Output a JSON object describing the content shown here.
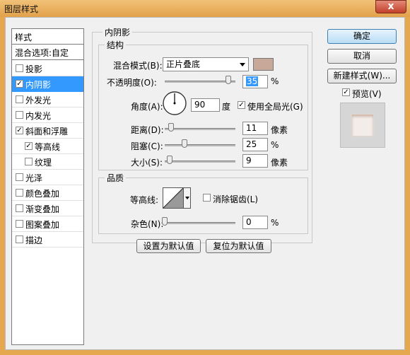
{
  "window": {
    "title": "图层样式",
    "close_glyph": "x"
  },
  "sidebar": {
    "header": "样式",
    "blend_options": "混合选项:自定",
    "items": [
      {
        "label": "投影",
        "checked": false,
        "selected": false,
        "indent": false
      },
      {
        "label": "内阴影",
        "checked": true,
        "selected": true,
        "indent": false
      },
      {
        "label": "外发光",
        "checked": false,
        "selected": false,
        "indent": false
      },
      {
        "label": "内发光",
        "checked": false,
        "selected": false,
        "indent": false
      },
      {
        "label": "斜面和浮雕",
        "checked": true,
        "selected": false,
        "indent": false
      },
      {
        "label": "等高线",
        "checked": true,
        "selected": false,
        "indent": true
      },
      {
        "label": "纹理",
        "checked": false,
        "selected": false,
        "indent": true
      },
      {
        "label": "光泽",
        "checked": false,
        "selected": false,
        "indent": false
      },
      {
        "label": "颜色叠加",
        "checked": false,
        "selected": false,
        "indent": false
      },
      {
        "label": "渐变叠加",
        "checked": false,
        "selected": false,
        "indent": false
      },
      {
        "label": "图案叠加",
        "checked": false,
        "selected": false,
        "indent": false
      },
      {
        "label": "描边",
        "checked": false,
        "selected": false,
        "indent": false
      }
    ]
  },
  "panel": {
    "title": "内阴影",
    "structure": {
      "title": "结构",
      "blend_mode_label": "混合模式(B):",
      "blend_mode_value": "正片叠底",
      "shadow_color": "#c8a898",
      "opacity_label": "不透明度(O):",
      "opacity_value": "35",
      "percent": "%",
      "angle_label": "角度(A):",
      "angle_value": "90",
      "degree": "度",
      "global_light_label": "使用全局光(G)",
      "global_light_checked": true,
      "distance_label": "距离(D):",
      "distance_value": "11",
      "choke_label": "阻塞(C):",
      "choke_value": "25",
      "size_label": "大小(S):",
      "size_value": "9",
      "px": "像素"
    },
    "quality": {
      "title": "品质",
      "contour_label": "等高线:",
      "antialias_label": "消除锯齿(L)",
      "antialias_checked": false,
      "noise_label": "杂色(N):",
      "noise_value": "0",
      "percent": "%"
    },
    "make_default": "设置为默认值",
    "reset_default": "复位为默认值"
  },
  "actions": {
    "ok": "确定",
    "cancel": "取消",
    "new_style": "新建样式(W)...",
    "preview_label": "预览(V)",
    "preview_checked": true
  }
}
